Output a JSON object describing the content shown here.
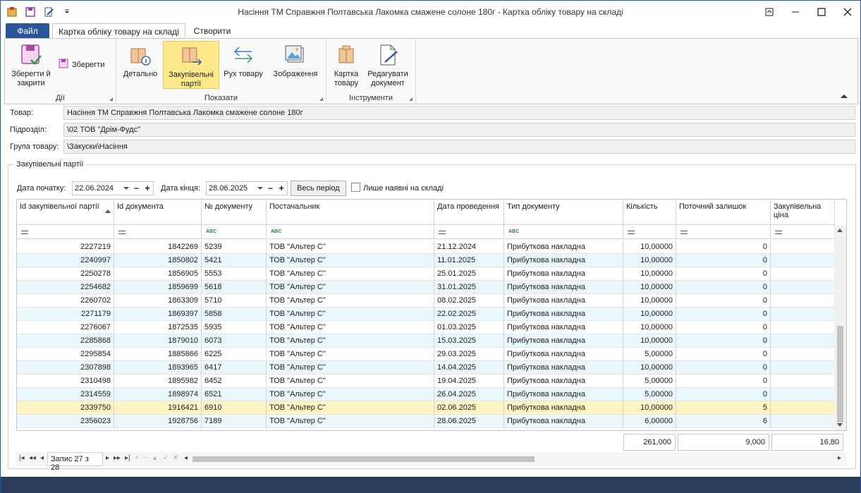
{
  "window": {
    "title": "Насіння ТМ Справжня Полтавська Лакомка смажене солоне 180г - Картка обліку товару на складі"
  },
  "ribbon": {
    "tabs": {
      "file": "Файл",
      "card": "Картка обліку товару на складі",
      "create": "Створити"
    },
    "groups": {
      "actions": {
        "label": "Дії",
        "save_close": "Зберегти й закрити",
        "save": "Зберегти"
      },
      "show": {
        "label": "Показати",
        "details": "Детально",
        "batches": "Закупівельні партії",
        "movement": "Рух товару",
        "images": "Зображення"
      },
      "tools": {
        "label": "Інструменти",
        "item_card": "Картка товару",
        "edit_doc": "Редагувати документ"
      }
    }
  },
  "form": {
    "product_label": "Товар:",
    "product_value": "Насіння ТМ Справжня Полтавська Лакомка смажене солоне 180г",
    "division_label": "Підрозділ:",
    "division_value": "\\02 ТОВ \"Дрім-Фудс\"",
    "group_label": "Група товару:",
    "group_value": "\\Закуски\\Насіння"
  },
  "batches": {
    "title": "Закупівельні партії",
    "date_from_label": "Дата початку:",
    "date_from": "22.06.2024",
    "date_to_label": "Дата кінця:",
    "date_to": "28.06.2025",
    "all_period": "Весь період",
    "only_in_stock": "Лише наявні на складі"
  },
  "grid": {
    "columns": [
      "Id закупівельної партії",
      "Id документа",
      "№ документу",
      "Постачальник",
      "Дата проведення",
      "Тип документу",
      "Кількість",
      "Поточний залишок",
      "Закупівельна ціна"
    ],
    "rows": [
      [
        "2227219",
        "1842269",
        "5239",
        "ТОВ \"Альтер С\"",
        "21.12.2024",
        "Прибуткова накладна",
        "10,00000",
        "0",
        ""
      ],
      [
        "2240997",
        "1850802",
        "5421",
        "ТОВ \"Альтер С\"",
        "11.01.2025",
        "Прибуткова накладна",
        "10,00000",
        "0",
        ""
      ],
      [
        "2250278",
        "1856905",
        "5553",
        "ТОВ \"Альтер С\"",
        "25.01.2025",
        "Прибуткова накладна",
        "10,00000",
        "0",
        ""
      ],
      [
        "2254682",
        "1859699",
        "5618",
        "ТОВ \"Альтер С\"",
        "31.01.2025",
        "Прибуткова накладна",
        "10,00000",
        "0",
        ""
      ],
      [
        "2260702",
        "1863309",
        "5710",
        "ТОВ \"Альтер С\"",
        "08.02.2025",
        "Прибуткова накладна",
        "10,00000",
        "0",
        ""
      ],
      [
        "2271179",
        "1869397",
        "5858",
        "ТОВ \"Альтер С\"",
        "22.02.2025",
        "Прибуткова накладна",
        "10,00000",
        "0",
        ""
      ],
      [
        "2276067",
        "1872535",
        "5935",
        "ТОВ \"Альтер С\"",
        "01.03.2025",
        "Прибуткова накладна",
        "10,00000",
        "0",
        ""
      ],
      [
        "2285868",
        "1879010",
        "6073",
        "ТОВ \"Альтер С\"",
        "15.03.2025",
        "Прибуткова накладна",
        "10,00000",
        "0",
        ""
      ],
      [
        "2295854",
        "1885866",
        "6225",
        "ТОВ \"Альтер С\"",
        "29.03.2025",
        "Прибуткова накладна",
        "5,00000",
        "0",
        ""
      ],
      [
        "2307898",
        "1893965",
        "6417",
        "ТОВ \"Альтер С\"",
        "14.04.2025",
        "Прибуткова накладна",
        "10,00000",
        "0",
        ""
      ],
      [
        "2310498",
        "1895982",
        "6452",
        "ТОВ \"Альтер С\"",
        "19.04.2025",
        "Прибуткова накладна",
        "5,00000",
        "0",
        ""
      ],
      [
        "2314559",
        "1898974",
        "6521",
        "ТОВ \"Альтер С\"",
        "26.04.2025",
        "Прибуткова накладна",
        "5,00000",
        "0",
        ""
      ],
      [
        "2339750",
        "1916421",
        "6910",
        "ТОВ \"Альтер С\"",
        "02.06.2025",
        "Прибуткова накладна",
        "10,00000",
        "5",
        ""
      ],
      [
        "2356023",
        "1928756",
        "7189",
        "ТОВ \"Альтер С\"",
        "28.06.2025",
        "Прибуткова накладна",
        "6,00000",
        "6",
        ""
      ]
    ],
    "selected_row": 12,
    "totals": {
      "qty": "261,000",
      "balance": "9,000",
      "price": "16,80"
    }
  },
  "navigator": {
    "record": "Запис 27 з 28"
  },
  "colors": {
    "accent": "#2b579a",
    "alt_row": "#eaf8fb",
    "selected_row": "#fdf3c3",
    "ribbon_selected": "#fde98a"
  }
}
